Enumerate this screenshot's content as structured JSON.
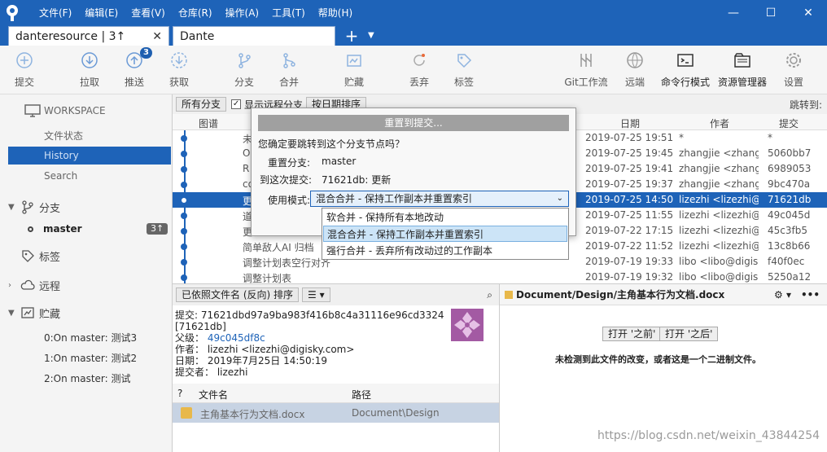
{
  "menu": [
    "文件(F)",
    "编辑(E)",
    "查看(V)",
    "仓库(R)",
    "操作(A)",
    "工具(T)",
    "帮助(H)"
  ],
  "tabs": [
    {
      "label": "danteresource | 3↑"
    },
    {
      "label": "Dante"
    }
  ],
  "toolbar": {
    "commit": "提交",
    "pull": "拉取",
    "push": "推送",
    "push_badge": "3",
    "fetch": "获取",
    "branch": "分支",
    "merge": "合并",
    "stash": "贮藏",
    "discard": "丢弃",
    "tag": "标签",
    "gitflow": "Git工作流",
    "remote": "远端",
    "terminal": "命令行模式",
    "explorer": "资源管理器",
    "settings": "设置"
  },
  "sidebar": {
    "workspace": "WORKSPACE",
    "file_status": "文件状态",
    "history": "History",
    "search": "Search",
    "branches": "分支",
    "branch_name": "master",
    "branch_count": "3↑",
    "tags": "标签",
    "remotes": "远程",
    "stashes": "贮藏",
    "stash_items": [
      "0:On master: 测试3",
      "1:On master: 测试2",
      "2:On master: 测试"
    ]
  },
  "filter": {
    "branches": "所有分支",
    "show_remote": "显示远程分支",
    "sort": "按日期排序",
    "jump_to": "跳转到:"
  },
  "columns": {
    "graph": "图谱",
    "date": "日期",
    "author": "作者",
    "commit": "提交"
  },
  "commits": [
    {
      "desc": "未",
      "date": "2019-07-25 19:51",
      "author": "*",
      "hash": "*",
      "selected": false
    },
    {
      "desc": "O",
      "date": "2019-07-25 19:45",
      "author": "zhangjie <zhangj",
      "hash": "5060bb7",
      "selected": false
    },
    {
      "desc": "R",
      "date": "2019-07-25 19:41",
      "author": "zhangjie <zhangj",
      "hash": "6989053",
      "selected": false
    },
    {
      "desc": "co",
      "date": "2019-07-25 19:37",
      "author": "zhangjie <zhangj",
      "hash": "9bc470a",
      "selected": false
    },
    {
      "desc": "更",
      "date": "2019-07-25 14:50",
      "author": "lizezhi <lizezhi@",
      "hash": "71621db",
      "selected": true
    },
    {
      "desc": "道",
      "date": "2019-07-25 11:55",
      "author": "lizezhi <lizezhi@",
      "hash": "49c045d",
      "selected": false
    },
    {
      "desc": "更",
      "date": "2019-07-22 17:15",
      "author": "lizezhi <lizezhi@",
      "hash": "45c3fb5",
      "selected": false
    },
    {
      "desc": "简单敌人AI 归档",
      "date": "2019-07-22 11:52",
      "author": "lizezhi <lizezhi@",
      "hash": "13c8b66",
      "selected": false
    },
    {
      "desc": "调整计划表空行对齐",
      "date": "2019-07-19 19:33",
      "author": "libo <libo@digis",
      "hash": "f40f0ec",
      "selected": false
    },
    {
      "desc": "调整计划表",
      "date": "2019-07-19 19:32",
      "author": "libo <libo@digis",
      "hash": "5250a12",
      "selected": false
    }
  ],
  "details": {
    "sort_label": "已依照文件名 (反向) 排序",
    "commit_line": "提交: 71621dbd97a9ba983f416b8c4a31116e96cd3324",
    "short_hash": "[71621db]",
    "parent_label": "父级：",
    "parent": "49c045df8c",
    "author_line": "作者： lizezhi <lizezhi@digisky.com>",
    "date_line": "日期： 2019年7月25日 14:50:19",
    "committer_line": "提交者： lizezhi"
  },
  "files": {
    "col_q": "?",
    "col_name": "文件名",
    "col_path": "路径",
    "rows": [
      {
        "name": "主角基本行为文档.docx",
        "path": "Document\\Design"
      }
    ]
  },
  "preview": {
    "title": "Document/Design/主角基本行为文档.docx",
    "btn_before": "打开 '之前'",
    "btn_after": "打开 '之后'",
    "message": "未检测到此文件的改变，或者这是一个二进制文件。"
  },
  "dialog": {
    "title": "重置到提交...",
    "question": "您确定要跳转到这个分支节点吗？",
    "branch_label": "重置分支:",
    "branch_value": "master",
    "to_label": "到这次提交:",
    "to_value": "71621db: 更新",
    "mode_label": "使用模式:",
    "mode_selected": "混合合并 - 保持工作副本并重置索引",
    "options": [
      "软合并 - 保持所有本地改动",
      "混合合并 - 保持工作副本并重置索引",
      "强行合并 - 丢弃所有改动过的工作副本"
    ]
  },
  "watermark": "https://blog.csdn.net/weixin_43844254",
  "colors": {
    "accent": "#1e63b8",
    "badge": "#1e5fb0"
  }
}
